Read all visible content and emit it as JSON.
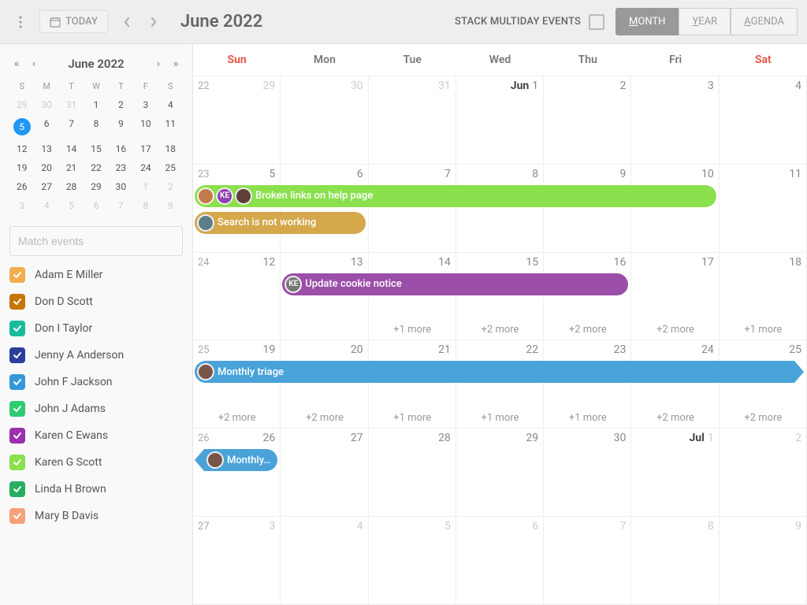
{
  "header": {
    "today": "TODAY",
    "title": "June 2022",
    "stack_label": "STACK MULTIDAY EVENTS",
    "views": {
      "month": "ONTH",
      "month_u": "M",
      "year": "EAR",
      "year_u": "Y",
      "agenda": "GENDA",
      "agenda_u": "A"
    }
  },
  "mini": {
    "title": "June 2022",
    "weekdays": [
      "S",
      "M",
      "T",
      "W",
      "T",
      "F",
      "S"
    ],
    "days": [
      {
        "n": "29",
        "m": true
      },
      {
        "n": "30",
        "m": true
      },
      {
        "n": "31",
        "m": true
      },
      {
        "n": "1"
      },
      {
        "n": "2"
      },
      {
        "n": "3"
      },
      {
        "n": "4"
      },
      {
        "n": "5",
        "sel": true
      },
      {
        "n": "6"
      },
      {
        "n": "7"
      },
      {
        "n": "8"
      },
      {
        "n": "9"
      },
      {
        "n": "10"
      },
      {
        "n": "11"
      },
      {
        "n": "12"
      },
      {
        "n": "13"
      },
      {
        "n": "14"
      },
      {
        "n": "15"
      },
      {
        "n": "16"
      },
      {
        "n": "17"
      },
      {
        "n": "18"
      },
      {
        "n": "19"
      },
      {
        "n": "20"
      },
      {
        "n": "21"
      },
      {
        "n": "22"
      },
      {
        "n": "23"
      },
      {
        "n": "24"
      },
      {
        "n": "25"
      },
      {
        "n": "26"
      },
      {
        "n": "27"
      },
      {
        "n": "28"
      },
      {
        "n": "29"
      },
      {
        "n": "30"
      },
      {
        "n": "1",
        "m": true
      },
      {
        "n": "2",
        "m": true
      },
      {
        "n": "3",
        "m": true
      },
      {
        "n": "4",
        "m": true
      },
      {
        "n": "5",
        "m": true
      },
      {
        "n": "6",
        "m": true
      },
      {
        "n": "7",
        "m": true
      },
      {
        "n": "8",
        "m": true
      },
      {
        "n": "9",
        "m": true
      }
    ]
  },
  "search": {
    "placeholder": "Match events"
  },
  "resources": [
    {
      "name": "Adam E Miller",
      "color": "#f0ad4e"
    },
    {
      "name": "Don D Scott",
      "color": "#c67605"
    },
    {
      "name": "Don I Taylor",
      "color": "#1abc9c"
    },
    {
      "name": "Jenny A Anderson",
      "color": "#2c3e9e"
    },
    {
      "name": "John F Jackson",
      "color": "#3498db"
    },
    {
      "name": "John J Adams",
      "color": "#2ecc71"
    },
    {
      "name": "Karen C Ewans",
      "color": "#9b2fae"
    },
    {
      "name": "Karen G Scott",
      "color": "#8be04e"
    },
    {
      "name": "Linda H Brown",
      "color": "#27ae60"
    },
    {
      "name": "Mary B Davis",
      "color": "#f8a07a"
    }
  ],
  "dayheaders": [
    "Sun",
    "Mon",
    "Tue",
    "Wed",
    "Thu",
    "Fri",
    "Sat"
  ],
  "weeks": [
    {
      "wk": "22",
      "cells": [
        {
          "n": "29",
          "m": true
        },
        {
          "n": "30",
          "m": true
        },
        {
          "n": "31",
          "m": true
        },
        {
          "mon": "Jun",
          "n": "1"
        },
        {
          "n": "2"
        },
        {
          "n": "3"
        },
        {
          "n": "4"
        }
      ]
    },
    {
      "wk": "23",
      "cells": [
        {
          "n": "5"
        },
        {
          "n": "6"
        },
        {
          "n": "7"
        },
        {
          "n": "8"
        },
        {
          "n": "9"
        },
        {
          "n": "10"
        },
        {
          "n": "11"
        }
      ]
    },
    {
      "wk": "24",
      "cells": [
        {
          "n": "12"
        },
        {
          "n": "13"
        },
        {
          "n": "14"
        },
        {
          "n": "15"
        },
        {
          "n": "16"
        },
        {
          "n": "17"
        },
        {
          "n": "18"
        }
      ]
    },
    {
      "wk": "25",
      "cells": [
        {
          "n": "19"
        },
        {
          "n": "20"
        },
        {
          "n": "21"
        },
        {
          "n": "22"
        },
        {
          "n": "23"
        },
        {
          "n": "24"
        },
        {
          "n": "25"
        }
      ]
    },
    {
      "wk": "26",
      "cells": [
        {
          "n": "26"
        },
        {
          "n": "27"
        },
        {
          "n": "28"
        },
        {
          "n": "29"
        },
        {
          "n": "30"
        },
        {
          "mon": "Jul",
          "n": "1",
          "m": true
        },
        {
          "n": "2",
          "m": true
        }
      ]
    },
    {
      "wk": "27",
      "cells": [
        {
          "n": "3",
          "m": true
        },
        {
          "n": "4",
          "m": true
        },
        {
          "n": "5",
          "m": true
        },
        {
          "n": "6",
          "m": true
        },
        {
          "n": "7",
          "m": true
        },
        {
          "n": "8",
          "m": true
        },
        {
          "n": "9",
          "m": true
        }
      ]
    }
  ],
  "events": {
    "broken_links": "Broken links on help page",
    "search_broken": "Search is not working",
    "cookie": "Update cookie notice",
    "monthly": "Monthly triage",
    "monthly2": "Monthly…"
  },
  "more": {
    "p1": "+1 more",
    "p2": "+2 more"
  },
  "initials": {
    "ke": "KE"
  }
}
